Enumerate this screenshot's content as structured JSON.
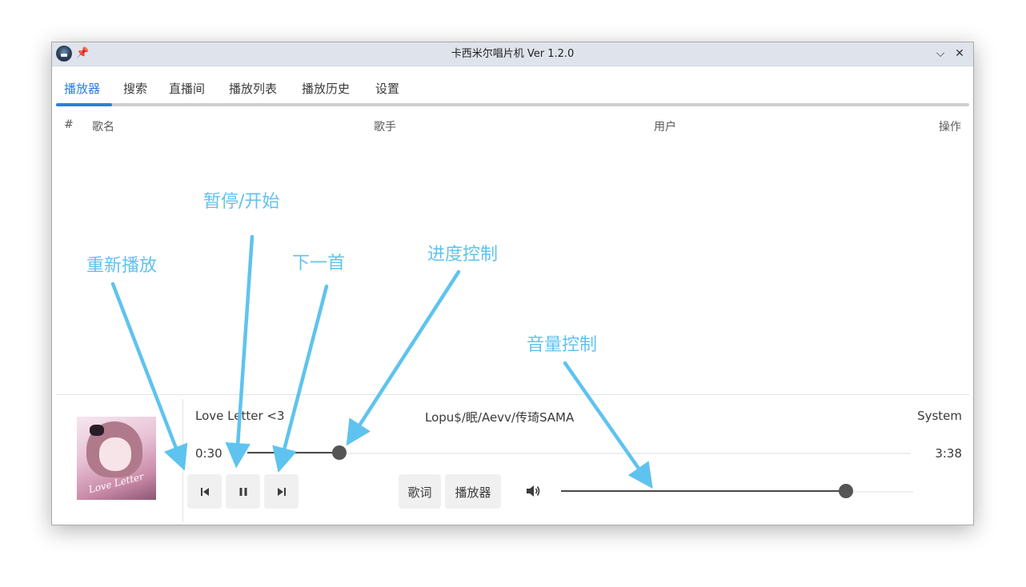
{
  "window": {
    "title": "卡西米尔唱片机 Ver 1.2.0"
  },
  "tabs": [
    {
      "label": "播放器",
      "active": true
    },
    {
      "label": "搜索"
    },
    {
      "label": "直播间"
    },
    {
      "label": "播放列表"
    },
    {
      "label": "播放历史"
    },
    {
      "label": "设置"
    }
  ],
  "table": {
    "columns": [
      "#",
      "歌名",
      "歌手",
      "用户",
      "操作"
    ],
    "rows": []
  },
  "player": {
    "title": "Love Letter <3",
    "artist": "Lopu$/眠/Aevv/传琦SAMA",
    "user": "System",
    "cover_text": "Love Letter",
    "elapsed": "0:30",
    "duration": "3:38",
    "progress": 0.139,
    "volume": 0.81,
    "lyrics_label": "歌词",
    "player_label": "播放器"
  },
  "annotations": {
    "replay": "重新播放",
    "pause_play": "暂停/开始",
    "next": "下一首",
    "progress_control": "进度控制",
    "volume_control": "音量控制"
  },
  "colors": {
    "accent": "#2f7de1",
    "annotation": "#5fc3ef",
    "knob": "#555555"
  },
  "icons": {
    "restart": "skip-previous-icon",
    "pause": "pause-icon",
    "next": "skip-next-icon",
    "volume": "speaker-icon",
    "pin": "pin-icon",
    "minimize": "chevron-down-icon",
    "close": "close-icon"
  }
}
